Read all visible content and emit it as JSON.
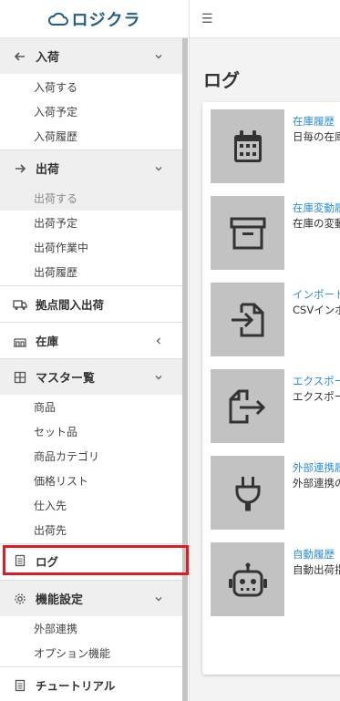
{
  "brand": {
    "name": "ロジクラ"
  },
  "header": {
    "menu_icon": "☰"
  },
  "sidebar": {
    "groups": [
      {
        "label": "入荷",
        "icon": "arrow-left-icon",
        "items": [
          "入荷する",
          "入荷予定",
          "入荷履歴"
        ]
      },
      {
        "label": "出荷",
        "icon": "arrow-right-icon",
        "items": [
          "出荷する",
          "出荷予定",
          "出荷作業中",
          "出荷履歴"
        ],
        "active_item": "出荷する"
      },
      {
        "label": "拠点間入出荷",
        "icon": "truck-icon"
      },
      {
        "label": "在庫",
        "icon": "inventory-icon"
      },
      {
        "label": "マスター覧",
        "icon": "table-icon",
        "items": [
          "商品",
          "セット品",
          "商品カテゴリ",
          "価格リスト",
          "仕入先",
          "出荷先"
        ]
      },
      {
        "label": "ログ",
        "icon": "document-icon"
      },
      {
        "label": "機能設定",
        "icon": "gear-icon",
        "items": [
          "外部連携",
          "オプション機能"
        ]
      },
      {
        "label": "チュートリアル",
        "icon": "document-icon"
      }
    ]
  },
  "main": {
    "title": "ログ",
    "logs": [
      {
        "icon": "calendar-icon",
        "link": "在庫履歴",
        "desc": "日毎の在庫"
      },
      {
        "icon": "archive-icon",
        "link": "在庫変動履歴",
        "desc": "在庫の変動"
      },
      {
        "icon": "import-icon",
        "link": "インポート",
        "desc": "CSVインポート"
      },
      {
        "icon": "export-icon",
        "link": "エクスポート",
        "desc": "エクスポート"
      },
      {
        "icon": "plug-icon",
        "link": "外部連携履歴",
        "desc": "外部連携の"
      },
      {
        "icon": "robot-icon",
        "link": "自動履歴",
        "desc": "自動出荷指"
      }
    ]
  },
  "colors": {
    "accent": "#2b8ed8",
    "brand": "#1f5f80",
    "highlight": "#e01c22",
    "tile": "#c2c2c2"
  }
}
